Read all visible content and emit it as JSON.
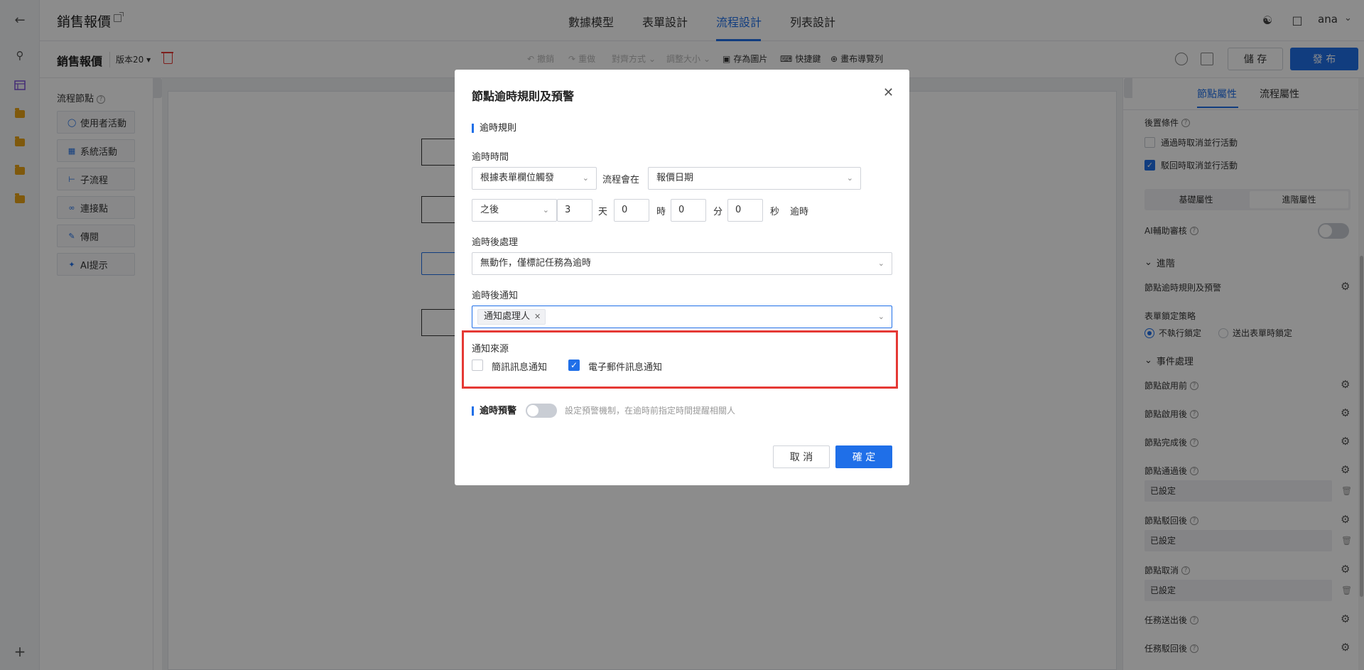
{
  "header": {
    "app_title": "銷售報價",
    "tabs": [
      {
        "label": "數據模型"
      },
      {
        "label": "表單設計"
      },
      {
        "label": "流程設計"
      },
      {
        "label": "列表設計"
      }
    ],
    "active_tab": "流程設計",
    "user": "ana"
  },
  "toolbar": {
    "doc_title": "銷售報價",
    "version": "版本20",
    "undo": "撤銷",
    "redo": "重做",
    "layout": "對齊方式",
    "resize": "調整大小",
    "save_image": "存為圖片",
    "shortcuts": "快捷鍵",
    "navigator": "畫布導覽列",
    "save": "儲 存",
    "publish": "發 布"
  },
  "left_panel": {
    "title": "流程節點",
    "items": [
      {
        "label": "使用者活動",
        "icon": "user-icon"
      },
      {
        "label": "系統活動",
        "icon": "grid-icon"
      },
      {
        "label": "子流程",
        "icon": "subflow-icon"
      },
      {
        "label": "連接點",
        "icon": "link-icon"
      },
      {
        "label": "傳閱",
        "icon": "circulate-icon"
      },
      {
        "label": "AI提示",
        "icon": "ai-icon"
      }
    ]
  },
  "right_panel": {
    "tabs": [
      {
        "label": "節點屬性"
      },
      {
        "label": "流程屬性"
      }
    ],
    "post_condition": "後置條件",
    "cb_cancel_on_pass": "通過時取消並行活動",
    "cb_cancel_on_reject": "駁回時取消並行活動",
    "seg_basic": "基礎屬性",
    "seg_advanced": "進階屬性",
    "ai_review": "AI輔助審核",
    "advanced": "進階",
    "timeout_rules": "節點逾時規則及預警",
    "form_lock": "表單鎖定策略",
    "radio_no_lock": "不執行鎖定",
    "radio_lock_on_submit": "送出表單時鎖定",
    "event_handling": "事件處理",
    "events": [
      {
        "label": "節點啟用前",
        "value": ""
      },
      {
        "label": "節點啟用後",
        "value": ""
      },
      {
        "label": "節點完成後",
        "value": ""
      },
      {
        "label": "節點通過後",
        "value": "已設定"
      },
      {
        "label": "節點駁回後",
        "value": "已設定"
      },
      {
        "label": "節點取消",
        "value": "已設定"
      },
      {
        "label": "任務送出後",
        "value": ""
      },
      {
        "label": "任務駁回後",
        "value": ""
      }
    ]
  },
  "modal": {
    "title": "節點逾時規則及預警",
    "section_rules": "逾時規則",
    "timeout_time_label": "逾時時間",
    "trigger_select": "根據表單欄位觸發",
    "flow_will": "流程會在",
    "date_field": "報價日期",
    "after_select": "之後",
    "days": "3",
    "days_unit": "天",
    "hours": "0",
    "hours_unit": "時",
    "minutes": "0",
    "minutes_unit": "分",
    "seconds": "0",
    "seconds_unit": "秒",
    "timeout_suffix": "逾時",
    "after_handle_label": "逾時後處理",
    "after_handle_value": "無動作，僅標記任務為逾時",
    "notify_label": "逾時後通知",
    "notify_tag": "通知處理人",
    "source_label": "通知來源",
    "sms_label": "簡訊訊息通知",
    "email_label": "電子郵件訊息通知",
    "sms_checked": false,
    "email_checked": true,
    "warning_label": "逾時預警",
    "warning_hint": "設定預警機制，在逾時前指定時間提醒相關人",
    "cancel": "取 消",
    "confirm": "確 定"
  },
  "colors": {
    "accent": "#1f6fe8",
    "highlight_border": "#e53935"
  }
}
